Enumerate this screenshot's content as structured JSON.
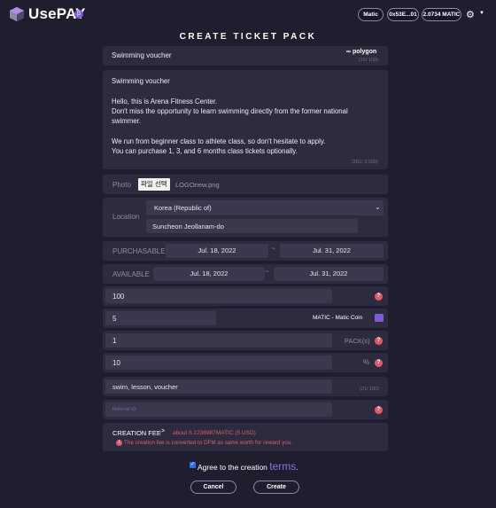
{
  "header": {
    "brand": "UsePAY",
    "beta": "β",
    "network": "Matic",
    "address": "0x53E...01",
    "balance": "2.0734 MATIC",
    "settings_icon": "gear-icon"
  },
  "page_title": "CREATE TICKET PACK",
  "form": {
    "name": {
      "value": "Swimming voucher",
      "counter": "(16/ 100)",
      "badge": "polygon"
    },
    "description": {
      "lines": [
        "Swimming voucher",
        "",
        "Hello, this is Arena Fitness Center.",
        "Don't miss the opportunity to learn swimming directly from the former national",
        "swimmer.",
        "",
        "We run from beginner class to athlete class, so don't hesitate to apply.",
        "You can purchase 1, 3, and 6 months class tickets optionally."
      ],
      "counter": "(281/ 3,000)"
    },
    "photo": {
      "label": "Photo",
      "button": "파일 선택",
      "filename": "LOGOnew.png"
    },
    "location": {
      "label": "Location",
      "country": "Korea (Republic of)",
      "city": "Suncheon Jeollanam-do"
    },
    "purchasable": {
      "label": "PURCHASABLE",
      "start": "Jul. 18, 2022",
      "sep": "~",
      "end": "Jul. 31, 2022"
    },
    "available": {
      "label": "AVAILABLE",
      "start": "Jul. 18, 2022",
      "sep": "~",
      "end": "Jul. 31, 2022"
    },
    "quantity": {
      "value": "100"
    },
    "price": {
      "value": "5",
      "currency": "MATIC - Matic Coin"
    },
    "packs": {
      "value": "1",
      "unit": "PACK(s)"
    },
    "discount": {
      "value": "10",
      "unit": "%"
    },
    "tags": {
      "value": "swim,  lesson,  voucher",
      "counter": "(21/ 100)"
    },
    "referral": {
      "placeholder": "Referral ID"
    }
  },
  "fee": {
    "label": "CREATION FEE",
    "arrow": ">",
    "value": "about 6.1236987MATIC (5 USD)",
    "note": "The creation fee is converted to DFM as same worth for reward you."
  },
  "agree": {
    "text": "Agree to the creation ",
    "link": "terms",
    "end": "."
  },
  "buttons": {
    "cancel": "Cancel",
    "create": "Create"
  },
  "colors": {
    "accent": "#7b5cd6",
    "warning": "#e05a6d",
    "background": "#1f1e2e",
    "card": "#2d2c3f"
  }
}
